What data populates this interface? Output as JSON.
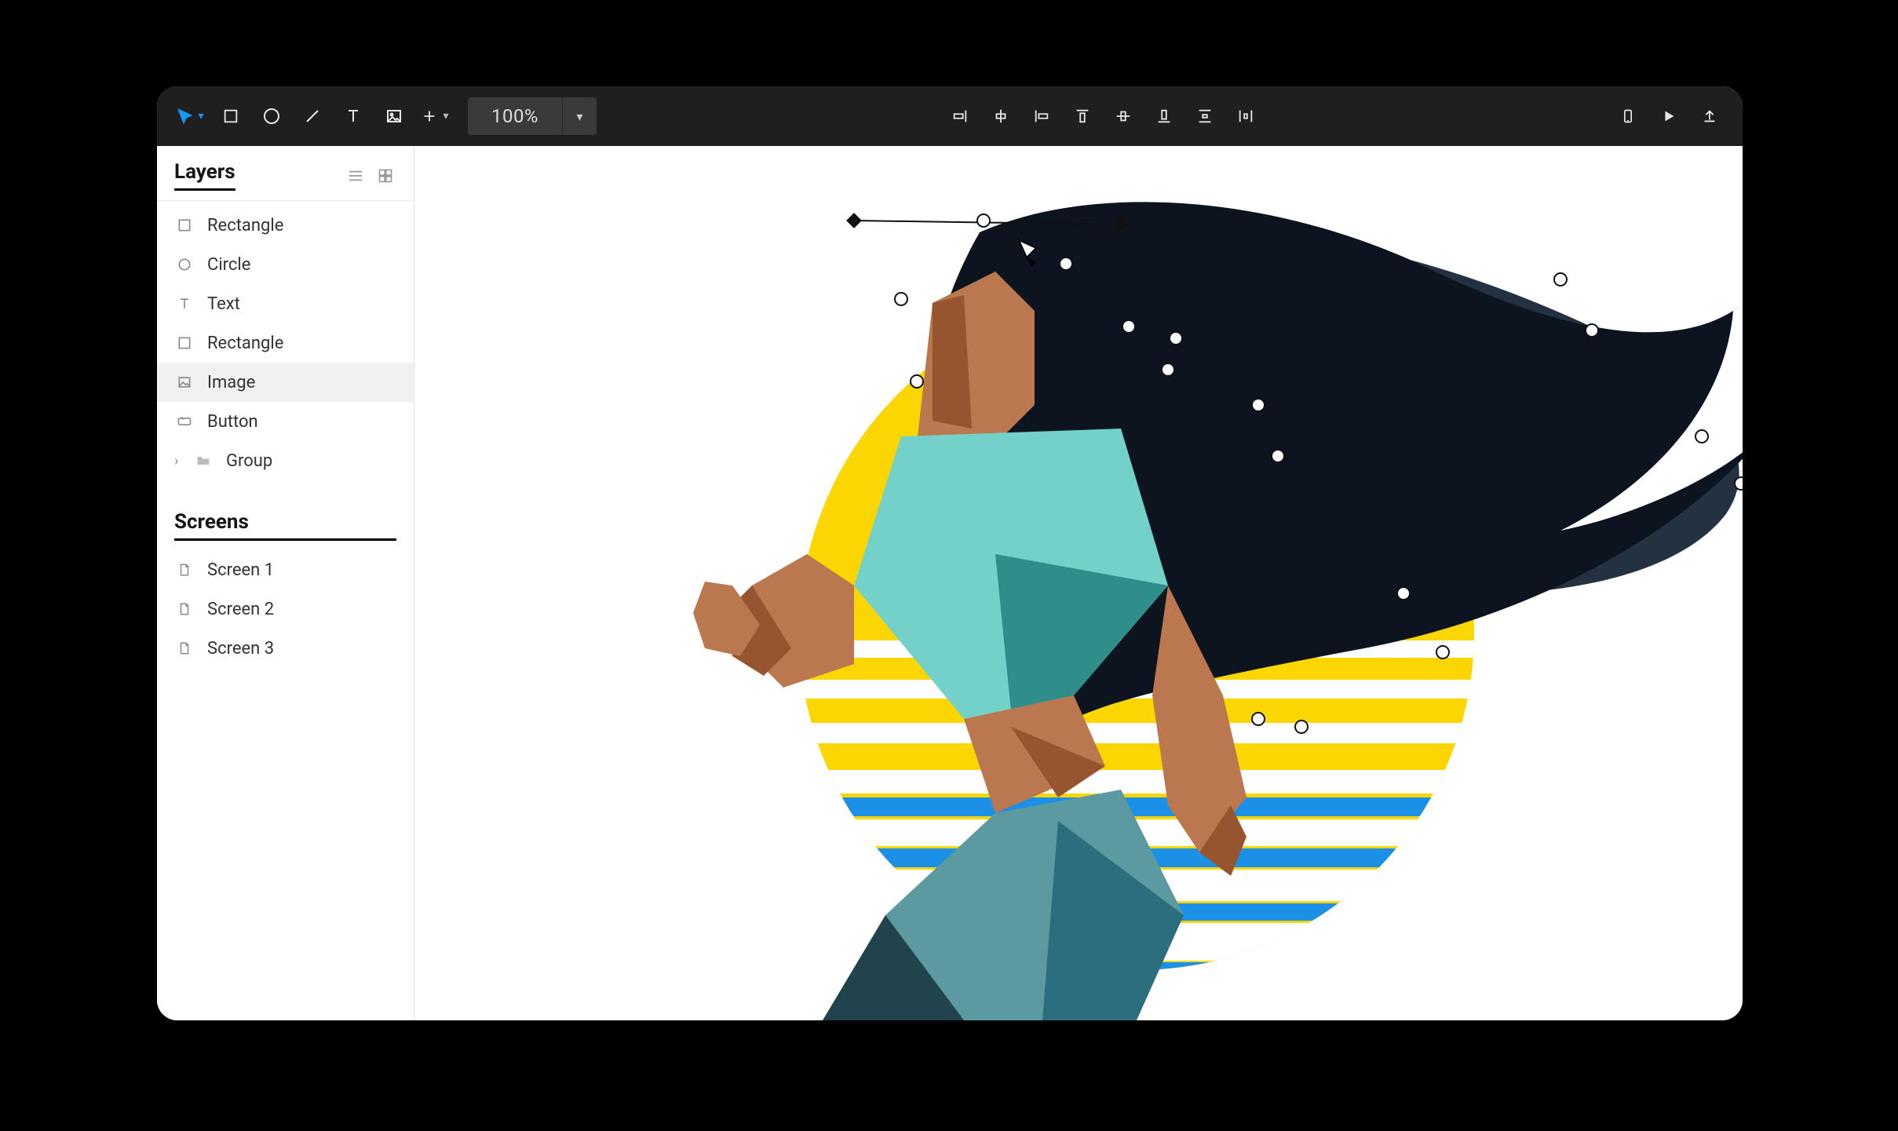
{
  "toolbar": {
    "zoom_value": "100%"
  },
  "sidebar": {
    "layers_title": "Layers",
    "screens_title": "Screens",
    "layers": [
      {
        "label": "Rectangle",
        "icon": "rect"
      },
      {
        "label": "Circle",
        "icon": "circle"
      },
      {
        "label": "Text",
        "icon": "text"
      },
      {
        "label": "Rectangle",
        "icon": "rect"
      },
      {
        "label": "Image",
        "icon": "image",
        "selected": true
      },
      {
        "label": "Button",
        "icon": "button"
      },
      {
        "label": "Group",
        "icon": "folder",
        "expandable": true
      }
    ],
    "screens": [
      {
        "label": "Screen 1"
      },
      {
        "label": "Screen 2"
      },
      {
        "label": "Screen 3"
      }
    ]
  },
  "colors": {
    "accent": "#139af2",
    "sun_yellow": "#fcd600",
    "stripe_blue": "#1c8fe6",
    "hair": "#0c1420",
    "skin": "#bb784f",
    "skin_shadow": "#97552f",
    "shirt": "#74d1c9",
    "shirt_dark": "#2f8d8a",
    "pants": "#2c6d7e",
    "pants_light": "#5c9aa2"
  }
}
